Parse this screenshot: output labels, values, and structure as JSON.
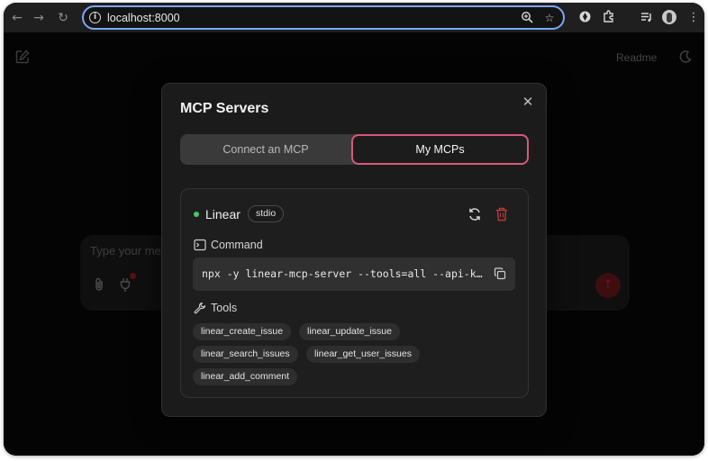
{
  "browser": {
    "back_icon": "arrow-left",
    "forward_icon": "arrow-right",
    "reload_icon": "reload",
    "url": "localhost:8000",
    "icons": [
      "zoom-icon",
      "star-icon",
      "extension-icon",
      "puzzle-icon",
      "media-icon",
      "profile-avatar",
      "menu-icon"
    ]
  },
  "app": {
    "readme_label": "Readme",
    "chat_placeholder": "Type your me"
  },
  "modal": {
    "title": "MCP Servers",
    "close_label": "✕",
    "tabs": [
      {
        "label": "Connect an MCP",
        "active": false
      },
      {
        "label": "My MCPs",
        "active": true
      }
    ],
    "accent_color": "#d9577a",
    "server": {
      "name": "Linear",
      "status_color": "#4cc46a",
      "transport": "stdio",
      "command_label": "Command",
      "command": "npx -y linear-mcp-server --tools=all --api-k…",
      "tools_label": "Tools",
      "tools": [
        "linear_create_issue",
        "linear_update_issue",
        "linear_search_issues",
        "linear_get_user_issues",
        "linear_add_comment"
      ]
    }
  }
}
